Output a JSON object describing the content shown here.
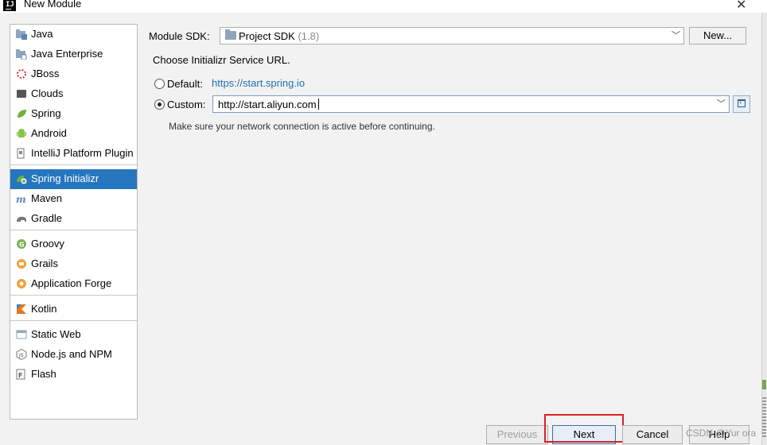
{
  "window": {
    "title": "New Module",
    "app_icon_text": "IJ"
  },
  "sidebar": {
    "groups": [
      [
        {
          "label": "Java",
          "icon": "java-folder-icon"
        },
        {
          "label": "Java Enterprise",
          "icon": "java-enterprise-icon"
        },
        {
          "label": "JBoss",
          "icon": "jboss-icon"
        },
        {
          "label": "Clouds",
          "icon": "clouds-icon"
        },
        {
          "label": "Spring",
          "icon": "spring-leaf-icon"
        },
        {
          "label": "Android",
          "icon": "android-icon"
        },
        {
          "label": "IntelliJ Platform Plugin",
          "icon": "intellij-plugin-icon"
        }
      ],
      [
        {
          "label": "Spring Initializr",
          "icon": "spring-initializr-icon",
          "selected": true
        },
        {
          "label": "Maven",
          "icon": "maven-icon"
        },
        {
          "label": "Gradle",
          "icon": "gradle-icon"
        }
      ],
      [
        {
          "label": "Groovy",
          "icon": "groovy-icon"
        },
        {
          "label": "Grails",
          "icon": "grails-icon"
        },
        {
          "label": "Application Forge",
          "icon": "application-forge-icon"
        }
      ],
      [
        {
          "label": "Kotlin",
          "icon": "kotlin-icon"
        }
      ],
      [
        {
          "label": "Static Web",
          "icon": "static-web-icon"
        },
        {
          "label": "Node.js and NPM",
          "icon": "nodejs-icon"
        },
        {
          "label": "Flash",
          "icon": "flash-icon"
        }
      ]
    ]
  },
  "main": {
    "sdk_label": "Module SDK:",
    "sdk_value": "Project SDK",
    "sdk_hint": "(1.8)",
    "new_button": "New...",
    "choose_label": "Choose Initializr Service URL.",
    "default_label": "Default:",
    "default_url": "https://start.spring.io",
    "custom_label": "Custom:",
    "custom_url": "http://start.aliyun.com",
    "selected_option": "custom",
    "network_note": "Make sure your network connection is active before continuing."
  },
  "footer": {
    "previous": "Previous",
    "next": "Next",
    "cancel": "Cancel",
    "help": "Help",
    "highlight_color": "#d71f26"
  },
  "watermark": "CSDN @Yur ora",
  "colors": {
    "selection": "#2675bf",
    "link": "#2470b3"
  }
}
